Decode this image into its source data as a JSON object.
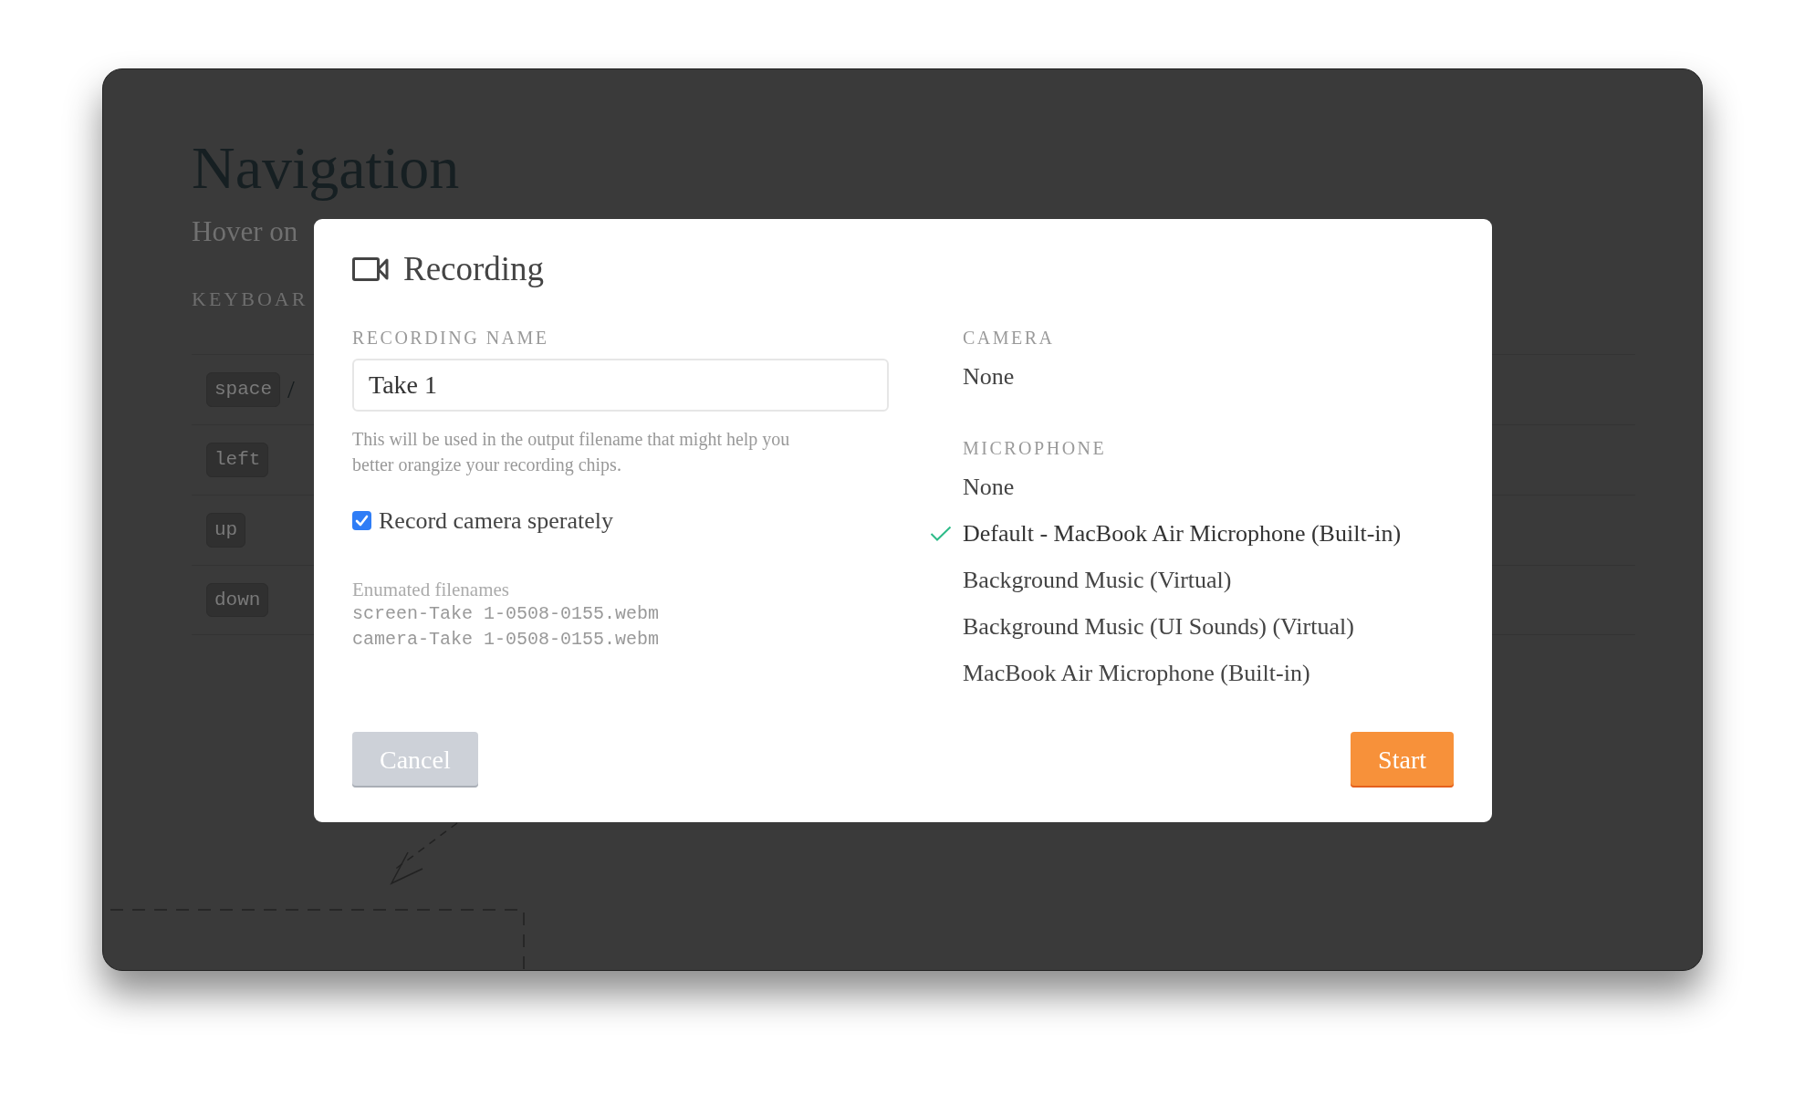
{
  "page": {
    "heading": "Navigation",
    "subtitle": "Hover on",
    "section_label": "KEYBOAR",
    "shortcuts": [
      {
        "keys": [
          "space"
        ],
        "separator": "/"
      },
      {
        "keys": [
          "left"
        ]
      },
      {
        "keys": [
          "up"
        ]
      },
      {
        "keys": [
          "down"
        ]
      }
    ]
  },
  "dialog": {
    "title": "Recording",
    "name_field": {
      "label": "RECORDING NAME",
      "value": "Take 1",
      "help": "This will be used in the output filename that might help you better orangize your recording chips."
    },
    "separate_camera": {
      "label": "Record camera sperately",
      "checked": true
    },
    "filenames": {
      "label": "Enumated filenames",
      "files": [
        "screen-Take 1-0508-0155.webm",
        "camera-Take 1-0508-0155.webm"
      ]
    },
    "camera": {
      "label": "CAMERA",
      "options": [
        {
          "label": "None",
          "selected": false
        }
      ]
    },
    "microphone": {
      "label": "MICROPHONE",
      "options": [
        {
          "label": "None",
          "selected": false
        },
        {
          "label": "Default - MacBook Air Microphone (Built-in)",
          "selected": true
        },
        {
          "label": "Background Music (Virtual)",
          "selected": false
        },
        {
          "label": "Background Music (UI Sounds) (Virtual)",
          "selected": false
        },
        {
          "label": "MacBook Air Microphone (Built-in)",
          "selected": false
        }
      ]
    },
    "buttons": [
      {
        "label": "Cancel",
        "kind": "secondary"
      },
      {
        "label": "Start",
        "kind": "primary"
      }
    ]
  }
}
